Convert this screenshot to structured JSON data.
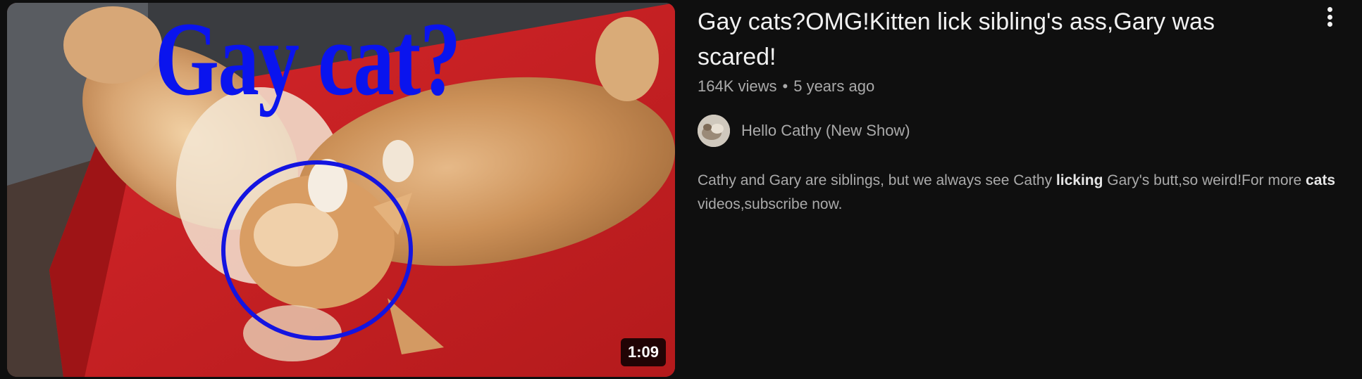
{
  "thumbnail": {
    "overlay_text": "Gay cat?",
    "duration": "1:09"
  },
  "video": {
    "title": "Gay cats?OMG!Kitten lick sibling's ass,Gary was scared!",
    "views": "164K views",
    "separator": "•",
    "age": "5 years ago"
  },
  "channel": {
    "name": "Hello Cathy (New Show)"
  },
  "description": {
    "part1": "Cathy and Gary are siblings, but we always see Cathy ",
    "bold1": "licking",
    "part2": " Gary's butt,so weird!For more ",
    "bold2": "cats",
    "part3": " videos,subscribe now."
  },
  "icons": {
    "more": "more-vert-icon"
  },
  "colors": {
    "background": "#0f0f0f",
    "title": "#f1f1f1",
    "secondary_text": "#aaaaaa",
    "thumbnail_text": "#0a14ee",
    "couch": "#c8201f"
  }
}
